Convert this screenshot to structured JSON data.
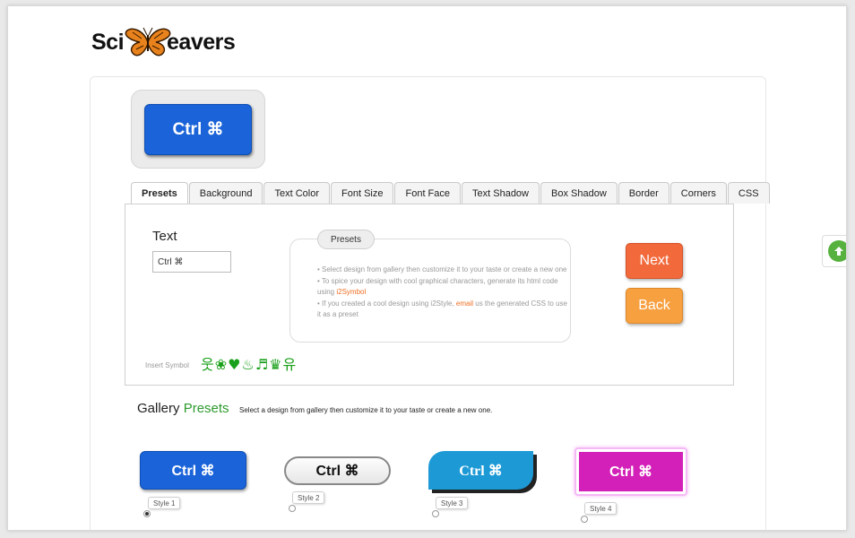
{
  "logo": {
    "left": "Sci",
    "right": "eavers"
  },
  "preview": {
    "label": "Ctrl ⌘"
  },
  "tabs": [
    "Presets",
    "Background",
    "Text Color",
    "Font Size",
    "Font Face",
    "Text Shadow",
    "Box Shadow",
    "Border",
    "Corners",
    "CSS"
  ],
  "editor": {
    "text_label": "Text",
    "text_value": "Ctrl ⌘",
    "info": {
      "title": "Presets",
      "line1": "• Select design from gallery then customize it to your taste or create a new one",
      "line2_pre": "• To spice your design with cool graphical characters, generate its html code using ",
      "line2_link": "i2Symbol",
      "line3_pre": "• If you created a cool design using i2Style, ",
      "line3_link": "email",
      "line3_post": " us the generated CSS to use it as a preset"
    },
    "next_label": "Next",
    "back_label": "Back",
    "insert_label": "Insert Symbol",
    "symbols": "웃❀♥♨♬♛유"
  },
  "gallery": {
    "title": "Gallery",
    "title_accent": "Presets",
    "subtitle": "Select a design from gallery then customize it to your taste or create a new one.",
    "styles": [
      {
        "label": "Style 1",
        "text": "Ctrl ⌘",
        "selected": true
      },
      {
        "label": "Style 2",
        "text": "Ctrl ⌘",
        "selected": false
      },
      {
        "label": "Style 3",
        "text": "Ctrl ⌘",
        "selected": false
      },
      {
        "label": "Style 4",
        "text": "Ctrl ⌘",
        "selected": false
      }
    ]
  },
  "colors": {
    "blue": "#1a63d9",
    "next": "#f26a3c",
    "back": "#f7a040",
    "green": "#2e9a2e",
    "magenta": "#d320b8"
  }
}
